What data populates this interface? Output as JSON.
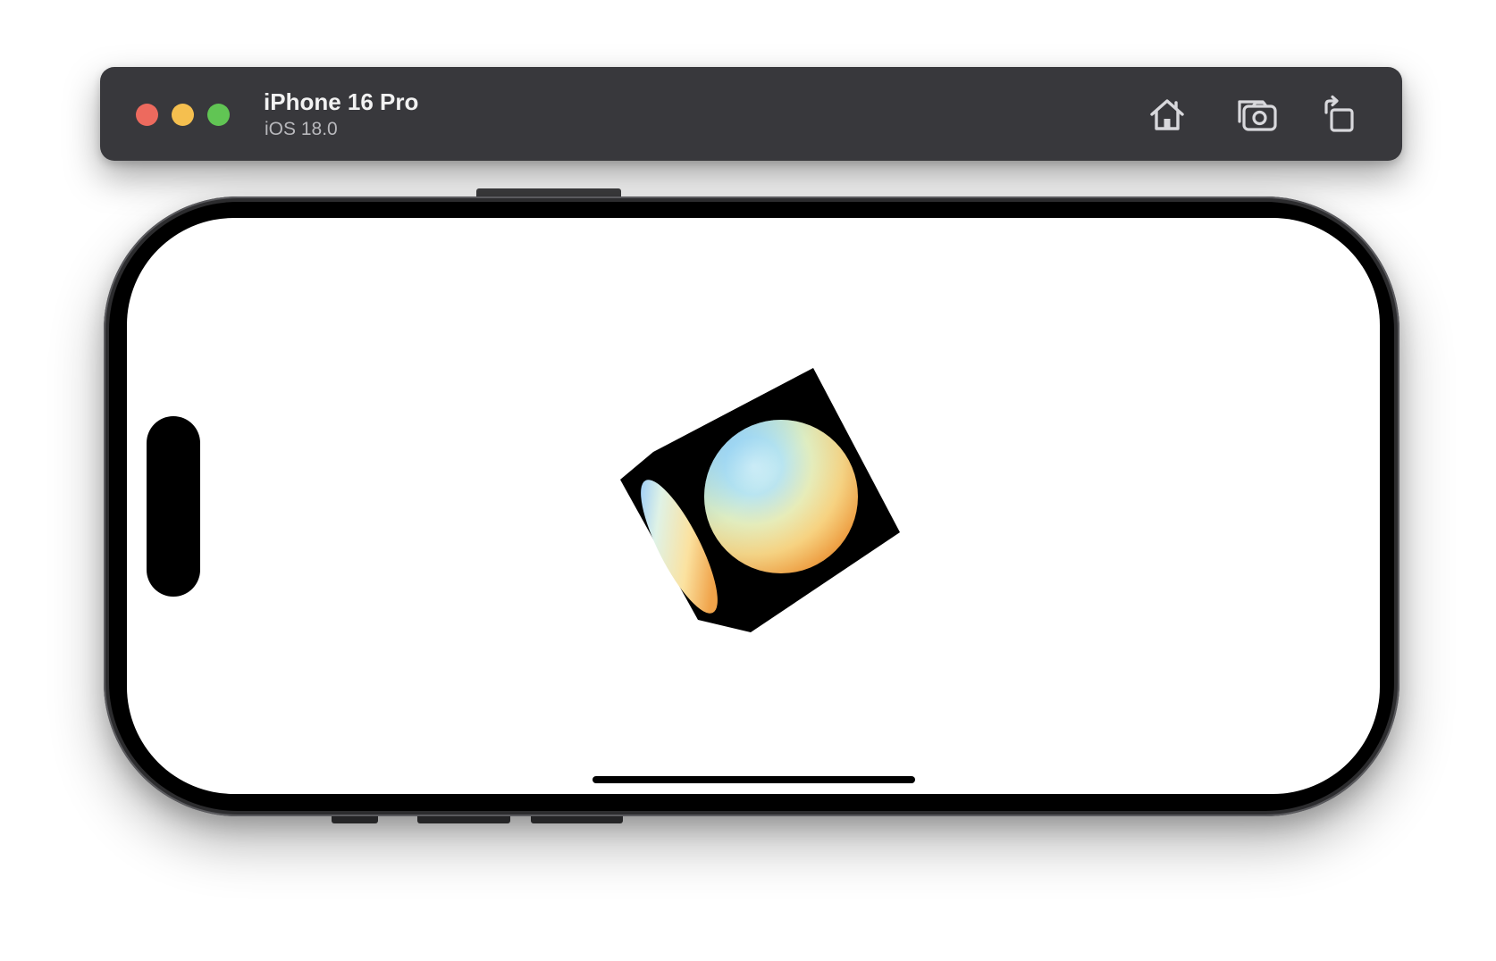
{
  "window": {
    "device_name": "iPhone 16 Pro",
    "os_version": "iOS 18.0",
    "controls": {
      "close_color": "#ed6a5e",
      "minimize_color": "#f5bf4f",
      "zoom_color": "#61c554"
    },
    "toolbar": [
      {
        "name": "home-button",
        "icon": "house-icon"
      },
      {
        "name": "screenshot-button",
        "icon": "camera-icon"
      },
      {
        "name": "rotate-button",
        "icon": "rotate-icon"
      }
    ]
  },
  "screen": {
    "background": "#ffffff",
    "scene": {
      "object": "cube",
      "cube_color": "#000000",
      "sphere_gradient": [
        "#8fd0ff",
        "#dff3d8",
        "#fde9a6",
        "#f4a94a",
        "#d2822e"
      ]
    }
  }
}
